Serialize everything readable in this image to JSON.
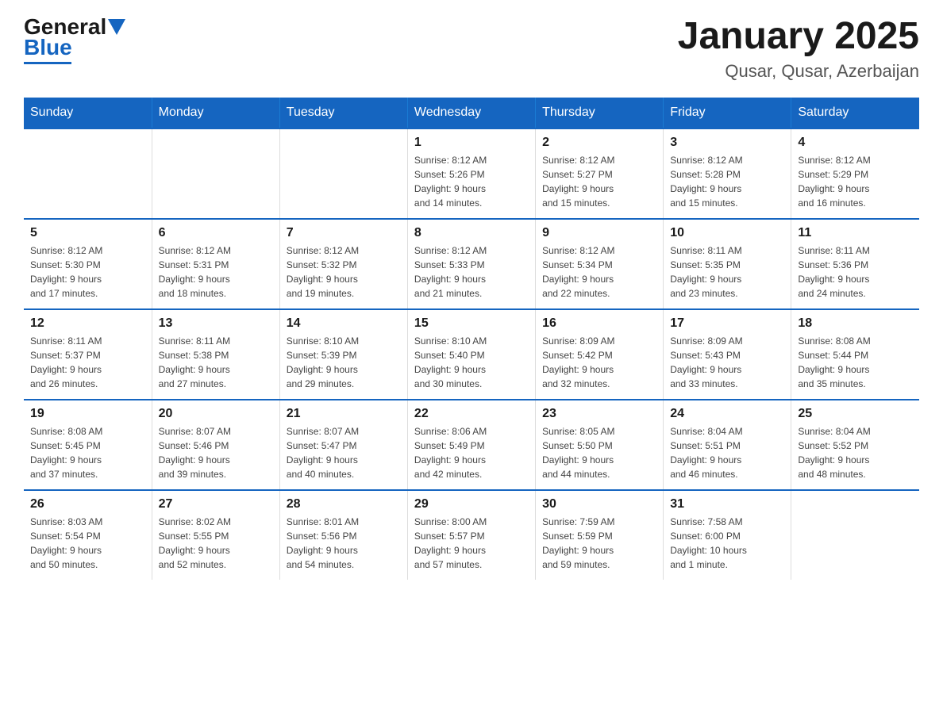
{
  "header": {
    "logo_general": "General",
    "logo_blue": "Blue",
    "title": "January 2025",
    "subtitle": "Qusar, Qusar, Azerbaijan"
  },
  "weekdays": [
    "Sunday",
    "Monday",
    "Tuesday",
    "Wednesday",
    "Thursday",
    "Friday",
    "Saturday"
  ],
  "weeks": [
    [
      {
        "day": "",
        "info": ""
      },
      {
        "day": "",
        "info": ""
      },
      {
        "day": "",
        "info": ""
      },
      {
        "day": "1",
        "info": "Sunrise: 8:12 AM\nSunset: 5:26 PM\nDaylight: 9 hours\nand 14 minutes."
      },
      {
        "day": "2",
        "info": "Sunrise: 8:12 AM\nSunset: 5:27 PM\nDaylight: 9 hours\nand 15 minutes."
      },
      {
        "day": "3",
        "info": "Sunrise: 8:12 AM\nSunset: 5:28 PM\nDaylight: 9 hours\nand 15 minutes."
      },
      {
        "day": "4",
        "info": "Sunrise: 8:12 AM\nSunset: 5:29 PM\nDaylight: 9 hours\nand 16 minutes."
      }
    ],
    [
      {
        "day": "5",
        "info": "Sunrise: 8:12 AM\nSunset: 5:30 PM\nDaylight: 9 hours\nand 17 minutes."
      },
      {
        "day": "6",
        "info": "Sunrise: 8:12 AM\nSunset: 5:31 PM\nDaylight: 9 hours\nand 18 minutes."
      },
      {
        "day": "7",
        "info": "Sunrise: 8:12 AM\nSunset: 5:32 PM\nDaylight: 9 hours\nand 19 minutes."
      },
      {
        "day": "8",
        "info": "Sunrise: 8:12 AM\nSunset: 5:33 PM\nDaylight: 9 hours\nand 21 minutes."
      },
      {
        "day": "9",
        "info": "Sunrise: 8:12 AM\nSunset: 5:34 PM\nDaylight: 9 hours\nand 22 minutes."
      },
      {
        "day": "10",
        "info": "Sunrise: 8:11 AM\nSunset: 5:35 PM\nDaylight: 9 hours\nand 23 minutes."
      },
      {
        "day": "11",
        "info": "Sunrise: 8:11 AM\nSunset: 5:36 PM\nDaylight: 9 hours\nand 24 minutes."
      }
    ],
    [
      {
        "day": "12",
        "info": "Sunrise: 8:11 AM\nSunset: 5:37 PM\nDaylight: 9 hours\nand 26 minutes."
      },
      {
        "day": "13",
        "info": "Sunrise: 8:11 AM\nSunset: 5:38 PM\nDaylight: 9 hours\nand 27 minutes."
      },
      {
        "day": "14",
        "info": "Sunrise: 8:10 AM\nSunset: 5:39 PM\nDaylight: 9 hours\nand 29 minutes."
      },
      {
        "day": "15",
        "info": "Sunrise: 8:10 AM\nSunset: 5:40 PM\nDaylight: 9 hours\nand 30 minutes."
      },
      {
        "day": "16",
        "info": "Sunrise: 8:09 AM\nSunset: 5:42 PM\nDaylight: 9 hours\nand 32 minutes."
      },
      {
        "day": "17",
        "info": "Sunrise: 8:09 AM\nSunset: 5:43 PM\nDaylight: 9 hours\nand 33 minutes."
      },
      {
        "day": "18",
        "info": "Sunrise: 8:08 AM\nSunset: 5:44 PM\nDaylight: 9 hours\nand 35 minutes."
      }
    ],
    [
      {
        "day": "19",
        "info": "Sunrise: 8:08 AM\nSunset: 5:45 PM\nDaylight: 9 hours\nand 37 minutes."
      },
      {
        "day": "20",
        "info": "Sunrise: 8:07 AM\nSunset: 5:46 PM\nDaylight: 9 hours\nand 39 minutes."
      },
      {
        "day": "21",
        "info": "Sunrise: 8:07 AM\nSunset: 5:47 PM\nDaylight: 9 hours\nand 40 minutes."
      },
      {
        "day": "22",
        "info": "Sunrise: 8:06 AM\nSunset: 5:49 PM\nDaylight: 9 hours\nand 42 minutes."
      },
      {
        "day": "23",
        "info": "Sunrise: 8:05 AM\nSunset: 5:50 PM\nDaylight: 9 hours\nand 44 minutes."
      },
      {
        "day": "24",
        "info": "Sunrise: 8:04 AM\nSunset: 5:51 PM\nDaylight: 9 hours\nand 46 minutes."
      },
      {
        "day": "25",
        "info": "Sunrise: 8:04 AM\nSunset: 5:52 PM\nDaylight: 9 hours\nand 48 minutes."
      }
    ],
    [
      {
        "day": "26",
        "info": "Sunrise: 8:03 AM\nSunset: 5:54 PM\nDaylight: 9 hours\nand 50 minutes."
      },
      {
        "day": "27",
        "info": "Sunrise: 8:02 AM\nSunset: 5:55 PM\nDaylight: 9 hours\nand 52 minutes."
      },
      {
        "day": "28",
        "info": "Sunrise: 8:01 AM\nSunset: 5:56 PM\nDaylight: 9 hours\nand 54 minutes."
      },
      {
        "day": "29",
        "info": "Sunrise: 8:00 AM\nSunset: 5:57 PM\nDaylight: 9 hours\nand 57 minutes."
      },
      {
        "day": "30",
        "info": "Sunrise: 7:59 AM\nSunset: 5:59 PM\nDaylight: 9 hours\nand 59 minutes."
      },
      {
        "day": "31",
        "info": "Sunrise: 7:58 AM\nSunset: 6:00 PM\nDaylight: 10 hours\nand 1 minute."
      },
      {
        "day": "",
        "info": ""
      }
    ]
  ]
}
